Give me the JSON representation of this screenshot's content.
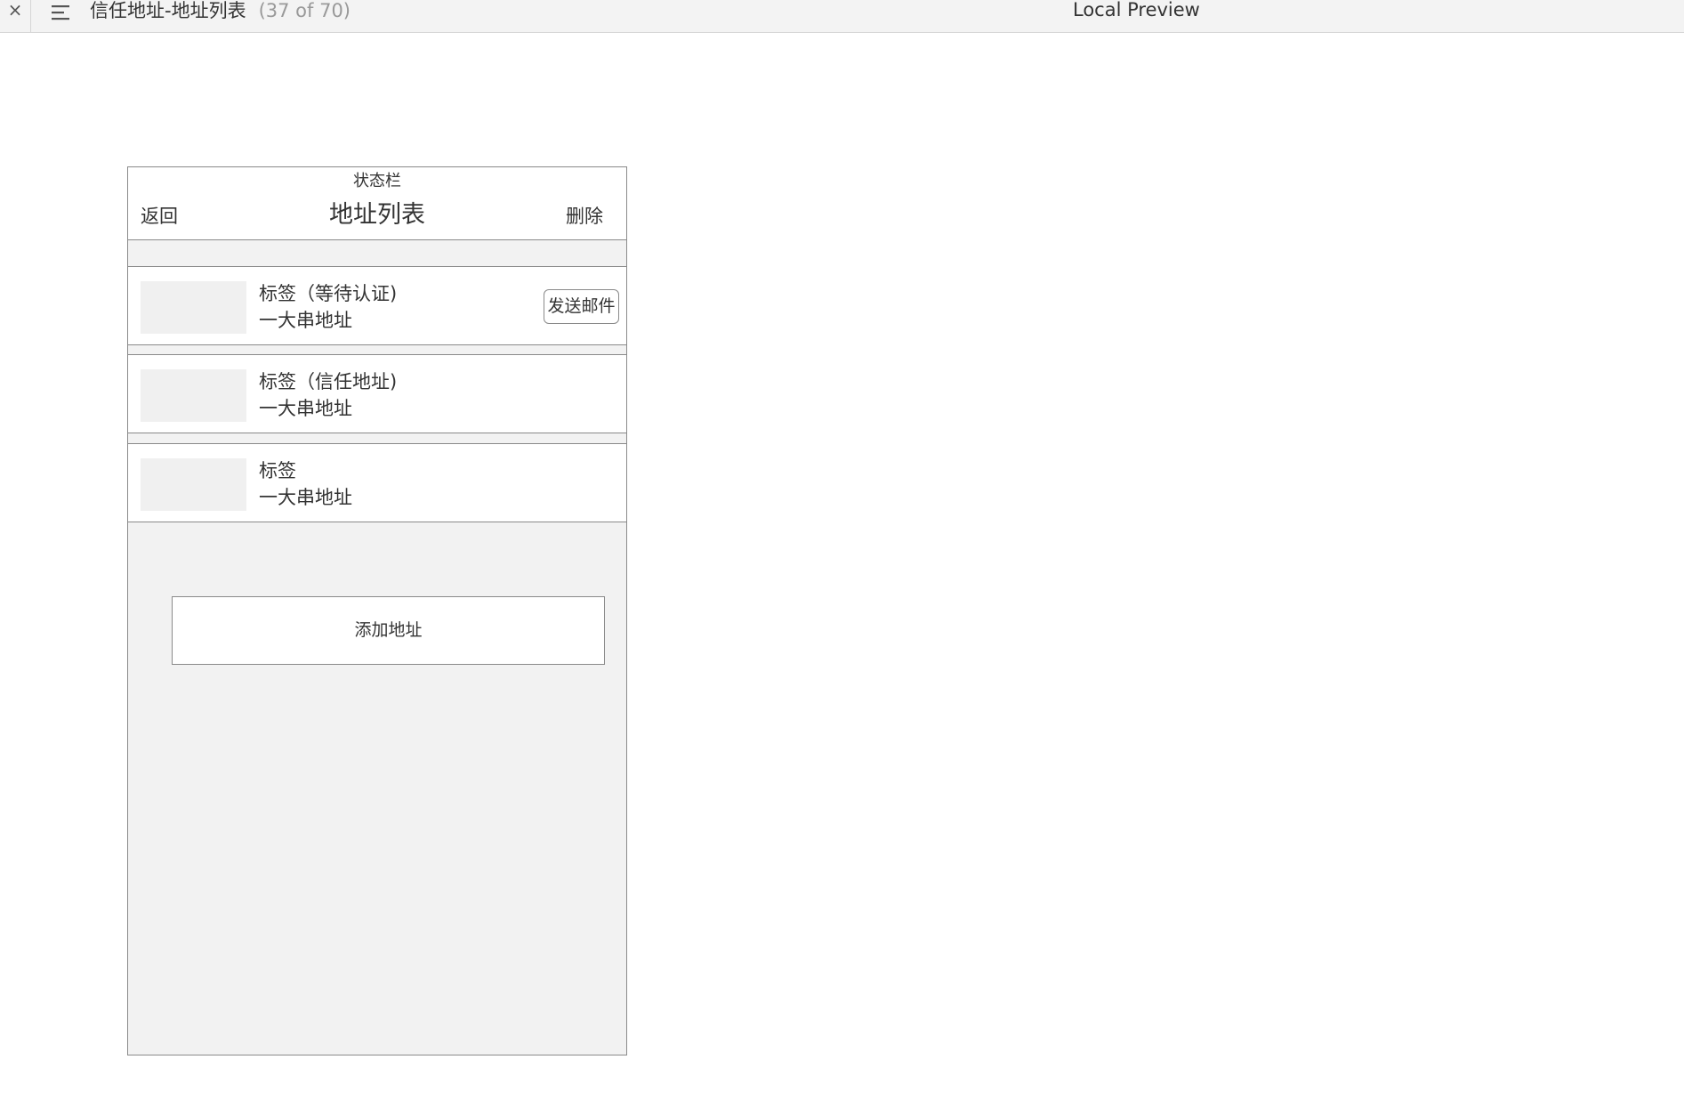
{
  "toolbar": {
    "close_symbol": "×",
    "menu_icon": "hamburger-menu-icon",
    "page_title": "信任地址-地址列表",
    "page_count": "(37 of 70)",
    "preview_title": "Local Preview"
  },
  "phone": {
    "status_bar": "状态栏",
    "nav": {
      "back": "返回",
      "title": "地址列表",
      "delete": "删除"
    },
    "items": [
      {
        "label": "标签（等待认证)",
        "address": "一大串地址",
        "action": "发送邮件"
      },
      {
        "label": "标签（信任地址)",
        "address": "一大串地址"
      },
      {
        "label": "标签",
        "address": "一大串地址"
      }
    ],
    "add_button": "添加地址"
  }
}
